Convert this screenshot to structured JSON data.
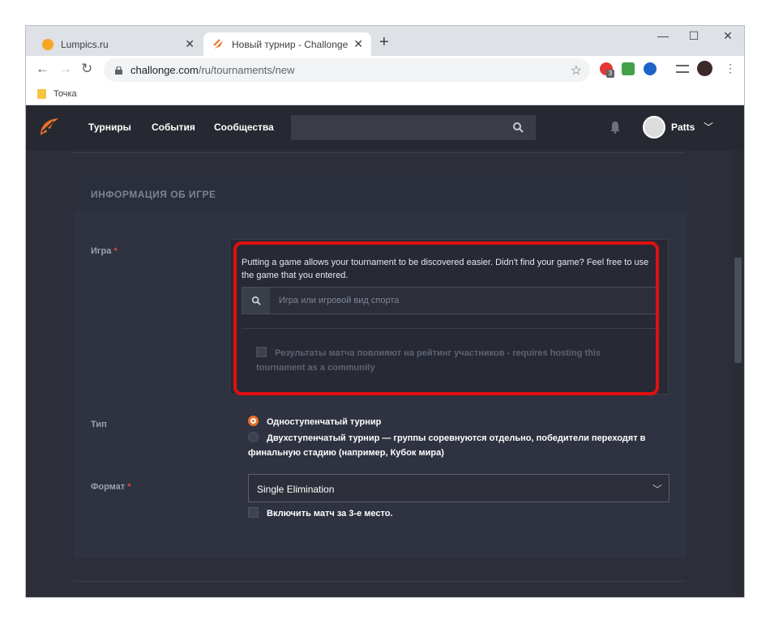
{
  "browser": {
    "tabs": [
      {
        "title": "Lumpics.ru",
        "close": "✕"
      },
      {
        "title": "Новый турнир - Challonge",
        "close": "✕"
      }
    ],
    "new_tab": "+",
    "window_controls": {
      "minimize": "—",
      "maximize": "☐",
      "close": "✕"
    },
    "url_host": "challonge.com",
    "url_path": "/ru/tournaments/new",
    "bookmark": "Точка",
    "extension_badge": "3"
  },
  "site": {
    "nav": [
      "Турниры",
      "События",
      "Сообщества"
    ],
    "username": "Patts"
  },
  "section": {
    "title": "ИНФОРМАЦИЯ ОБ ИГРЕ",
    "game_label": "Игра",
    "required_mark": "*",
    "game_help": "Putting a game allows your tournament to be discovered easier. Didn't find your game? Feel free to use the game that you entered.",
    "game_placeholder": "Игра или игровой вид спорта",
    "rating_checkbox": "Результаты матча повлияют на рейтинг участников - requires hosting this tournament as a community",
    "type_label": "Тип",
    "type_options": [
      "Одноступенчатый турнир",
      "Двухступенчатый турнир — группы соревнуются отдельно, победители переходят в финальную стадию (например, Кубок мира)"
    ],
    "format_label": "Формат",
    "format_value": "Single Elimination",
    "third_place": "Включить матч за 3-е место."
  },
  "colors": {
    "accent": "#e8702a",
    "highlight": "#e01010",
    "required": "#e5484d"
  }
}
